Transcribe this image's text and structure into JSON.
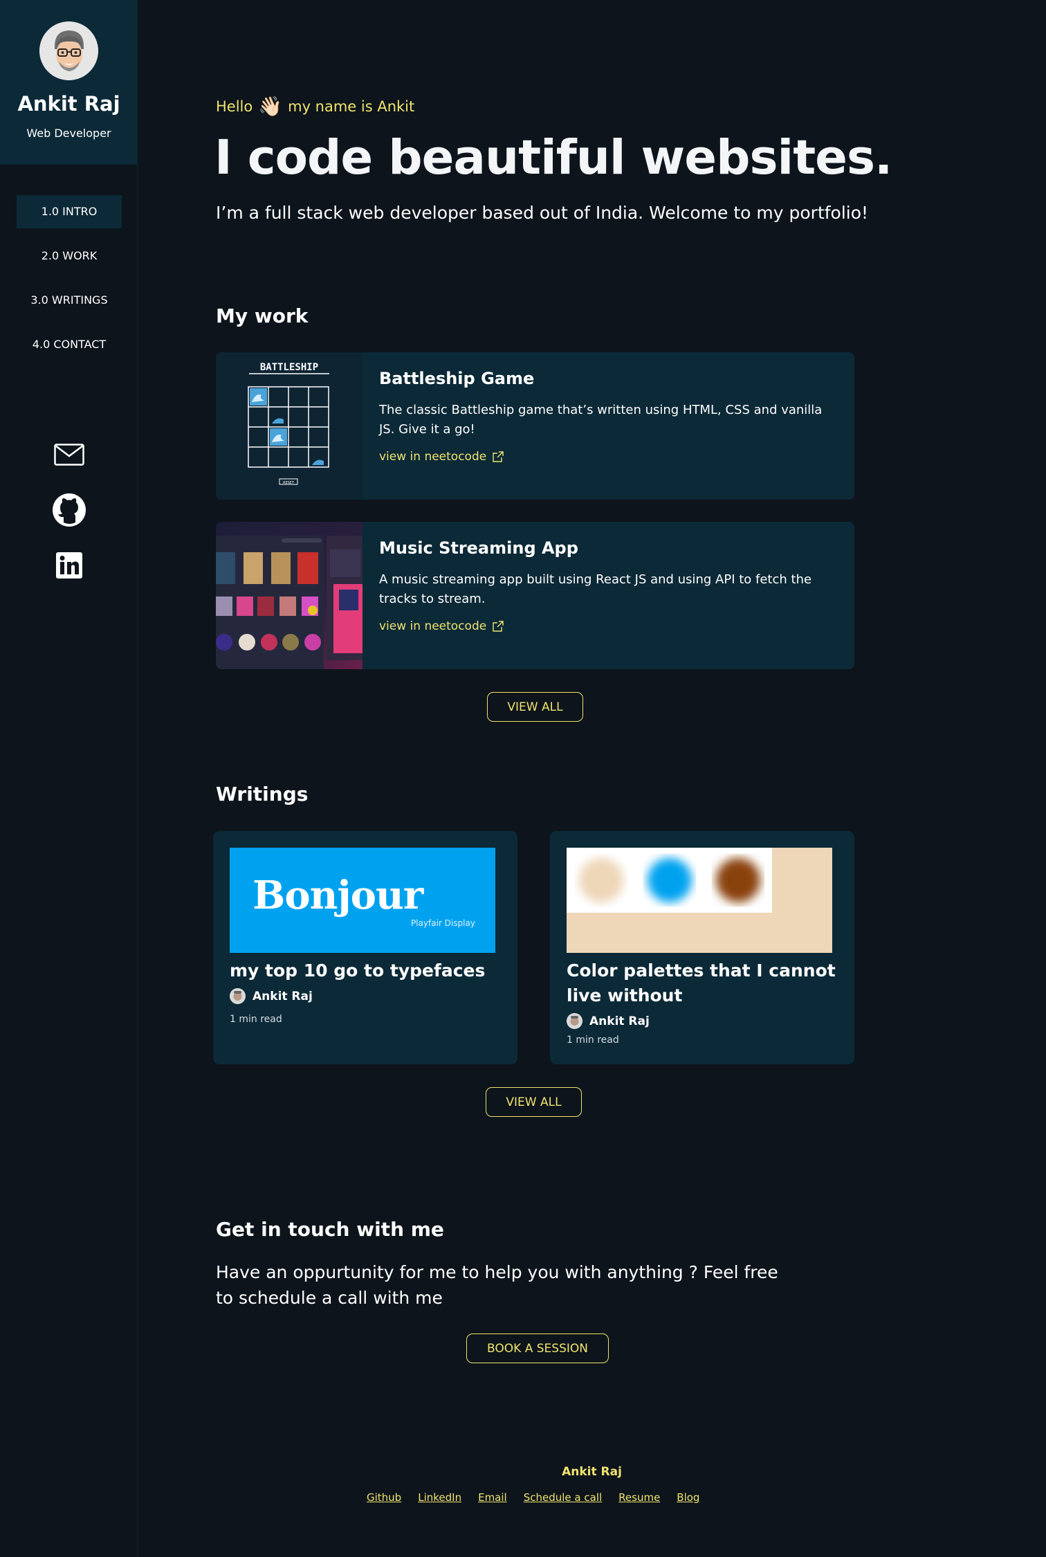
{
  "sidebar": {
    "name": "Ankit Raj",
    "role": "Web Developer",
    "nav": [
      {
        "label": "1.0 INTRO",
        "active": true
      },
      {
        "label": "2.0 WORK",
        "active": false
      },
      {
        "label": "3.0 WRITINGS",
        "active": false
      },
      {
        "label": "4.0 CONTACT",
        "active": false
      }
    ],
    "social_icons": [
      "mail-icon",
      "github-icon",
      "linkedin-icon"
    ]
  },
  "hero": {
    "hello_prefix": "Hello",
    "hello_emoji": "👋🏻",
    "hello_suffix": "my name is Ankit",
    "headline": "I code beautiful websites.",
    "intro": "I’m a full stack web developer based out of India. Welcome to my portfolio!"
  },
  "work": {
    "title": "My work",
    "projects": [
      {
        "title": "Battleship Game",
        "description": "The classic Battleship game that’s written using HTML, CSS and vanilla JS. Give it a go!",
        "link": "view in neetocode",
        "thumb_heading": "BATTLESHIP",
        "thumb_button": "RESET"
      },
      {
        "title": "Music Streaming App",
        "description": "A music streaming app built using React JS and using API to fetch the tracks to stream.",
        "link": "view in neetocode"
      }
    ],
    "view_all": "VIEW ALL"
  },
  "writings": {
    "title": "Writings",
    "posts": [
      {
        "title": "my top 10 go to typefaces",
        "author": "Ankit Raj",
        "read_time": "1 min read",
        "thumb_word": "Bonjour",
        "thumb_caption": "Playfair Display"
      },
      {
        "title": "Color palettes that I cannot live without",
        "author": "Ankit Raj",
        "read_time": "1 min read"
      }
    ],
    "view_all": "VIEW ALL"
  },
  "contact": {
    "title": "Get in touch with me",
    "text": "Have an oppurtunity for me to help you with anything ? Feel free to schedule a call with me",
    "button": "BOOK A SESSION"
  },
  "footer": {
    "name": "Ankit Raj",
    "links": [
      "Github",
      "LinkedIn",
      "Email",
      "Schedule a call",
      "Resume",
      "Blog"
    ]
  },
  "colors": {
    "background": "#0d141b",
    "card": "#0c2937",
    "accent": "#f0e46e",
    "text": "#ffffff"
  }
}
